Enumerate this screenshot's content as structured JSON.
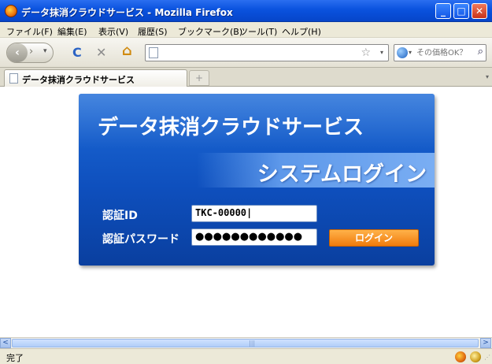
{
  "window": {
    "title": "データ抹消クラウドサービス - Mozilla Firefox",
    "buttons": {
      "minimize": "_",
      "maximize": "□",
      "close": "✕"
    }
  },
  "menu": {
    "items": [
      "ファイル(F)",
      "編集(E)",
      "表示(V)",
      "履歴(S)",
      "ブックマーク(B)",
      "ツール(T)",
      "ヘルプ(H)"
    ]
  },
  "nav": {
    "back_glyph": "‹",
    "forward_glyph": "›",
    "history_glyph": "▾",
    "reload_glyph": "C",
    "stop_glyph": "✕",
    "home_glyph": "⌂",
    "bookmark_glyph": "☆",
    "url_dropdown_glyph": "▾",
    "url_value": "",
    "search_placeholder": "その価格OK？",
    "search_engine_dropdown": "▾",
    "search_glyph": "⌕"
  },
  "tabs": {
    "active_label": "データ抹消クラウドサービス",
    "new_tab_glyph": "+",
    "list_glyph": "▾"
  },
  "page": {
    "service_title": "データ抹消クラウドサービス",
    "system_login": "システムログイン",
    "id_label": "認証ID",
    "id_value": "TKC-00000|",
    "password_label": "認証パスワード",
    "password_value": "●●●●●●●●●●●●",
    "login_button": "ログイン"
  },
  "scrollbar": {
    "left_glyph": "<",
    "right_glyph": ">",
    "grip_glyph": "|||"
  },
  "status": {
    "text": "完了",
    "grip_glyph": "⋰"
  },
  "colors": {
    "panel_blue": "#0e4fbd",
    "login_orange": "#f07b0c",
    "titlebar_blue": "#0a52de"
  }
}
